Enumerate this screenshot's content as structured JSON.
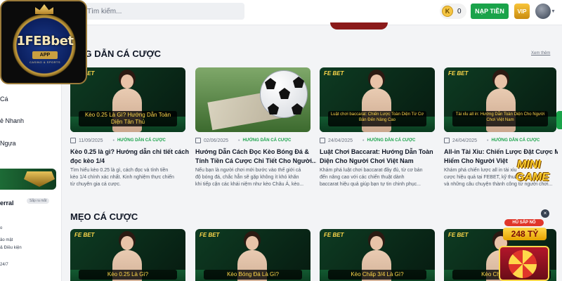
{
  "header": {
    "search_placeholder": "Tìm kiếm...",
    "coin_symbol": "K",
    "coin_balance": "0",
    "deposit_label": "NẠP TIỀN",
    "vip_label": "VIP"
  },
  "logo": {
    "name": "1FEBbet",
    "app": "APP",
    "tagline": "CASINO & SPORTS"
  },
  "sidebar": {
    "items": [
      "Cá",
      "ẻ Nhanh",
      "Ngựa"
    ],
    "referral_label": "erral",
    "referral_tag": "Sắp ra mắt",
    "small_links": [
      "o",
      "ảo mật",
      "& Điều kiện",
      "24/7"
    ]
  },
  "sections": [
    {
      "title": "ỚNG DẪN CÁ CƯỢC",
      "see_more": "Xem thêm",
      "cards": [
        {
          "thumb_brand": "FE BET",
          "thumb_caption": "Kèo 0.25 Là Gì? Hướng Dẫn Toàn Diện Tân Thủ",
          "date": "11/09/2025",
          "category": "HƯỚNG DẪN CÁ CƯỢC",
          "title_line1": "Kèo 0.25 là gì? Hướng dẫn chi tiết cách",
          "title_line2": "đọc kèo 1/4",
          "excerpt_line1": "Tìm hiểu kèo 0.25 là gì, cách đọc và tính tiền",
          "excerpt_line2": "kèo 1/4 chính xác nhất. Kinh nghiệm thực chiến",
          "excerpt_line3": "từ chuyên gia cá cược."
        },
        {
          "thumb_brand": "",
          "thumb_caption": "",
          "date": "02/06/2025",
          "category": "HƯỚNG DẪN CÁ CƯỢC",
          "title_line1": "Hướng Dẫn Cách Đọc Kèo Bóng Đá &",
          "title_line2": "Tính Tiền Cá Cược Chi Tiết Cho Người...",
          "excerpt_line1": "Nếu bạn là người chơi mới bước vào thế giới cá",
          "excerpt_line2": "độ bóng đá, chắc hẳn sẽ gặp không ít khó khăn",
          "excerpt_line3": "khi tiếp cận các khái niệm như kèo Châu Á, kèo..."
        },
        {
          "thumb_brand": "FE BET",
          "thumb_caption": "Luật chơi baccarat: Chiến Lược Toàn Diện Từ Cơ Bản Đến Nâng Cao",
          "date": "24/04/2025",
          "category": "HƯỚNG DẪN CÁ CƯỢC",
          "title_line1": "Luật Chơi Baccarat: Hướng Dẫn Toàn",
          "title_line2": "Diện Cho Người Chơi Việt Nam",
          "excerpt_line1": "Khám phá luật chơi baccarat đầy đủ, từ cơ bản",
          "excerpt_line2": "đến nâng cao với các chiến thuật dành",
          "excerpt_line3": "baccarat hiệu quả giúp bạn tự tin chinh phục..."
        },
        {
          "thumb_brand": "FE BET",
          "thumb_caption": "Tài xỉu all in: Hướng Dẫn Toàn Diện Cho Người Chơi Việt Nam",
          "date": "24/04/2025",
          "category": "HƯỚNG DẪN CÁ CƯỢC",
          "title_line1": "All-in Tài Xỉu: Chiến Lược Đặt Cược Mạo",
          "title_line2": "Hiểm Cho Người Việt",
          "excerpt_line1": "Khám phá chiến lược all in tài xỉu",
          "excerpt_line2": "cược hiệu quả tại FEBET, kỹ thuật",
          "excerpt_line3": "và những câu chuyện thành công từ người chơi..."
        }
      ]
    },
    {
      "title": "MẸO CÁ CƯỢC",
      "cards": [
        {
          "thumb_brand": "FE BET",
          "thumb_caption": "Kèo 0.25 Là Gì?"
        },
        {
          "thumb_brand": "FE BET",
          "thumb_caption": "Kèo Bóng Đá Là Gì?"
        },
        {
          "thumb_brand": "FE BET",
          "thumb_caption": "Kèo Chấp 3/4 Là Gì?"
        },
        {
          "thumb_brand": "FE BET",
          "thumb_caption": "Kèo Chấp 1 Trái"
        }
      ]
    }
  ],
  "promos": {
    "mini_game_line1": "MINI",
    "mini_game_line2": "GAME",
    "close": "×",
    "jackpot_label": "HŨ SẮP NỔ",
    "jackpot_amount": "248 TỶ"
  },
  "colors": {
    "accent_green": "#1aa34a",
    "gold": "#ffd84a",
    "dark_red": "#8b1a1a"
  }
}
